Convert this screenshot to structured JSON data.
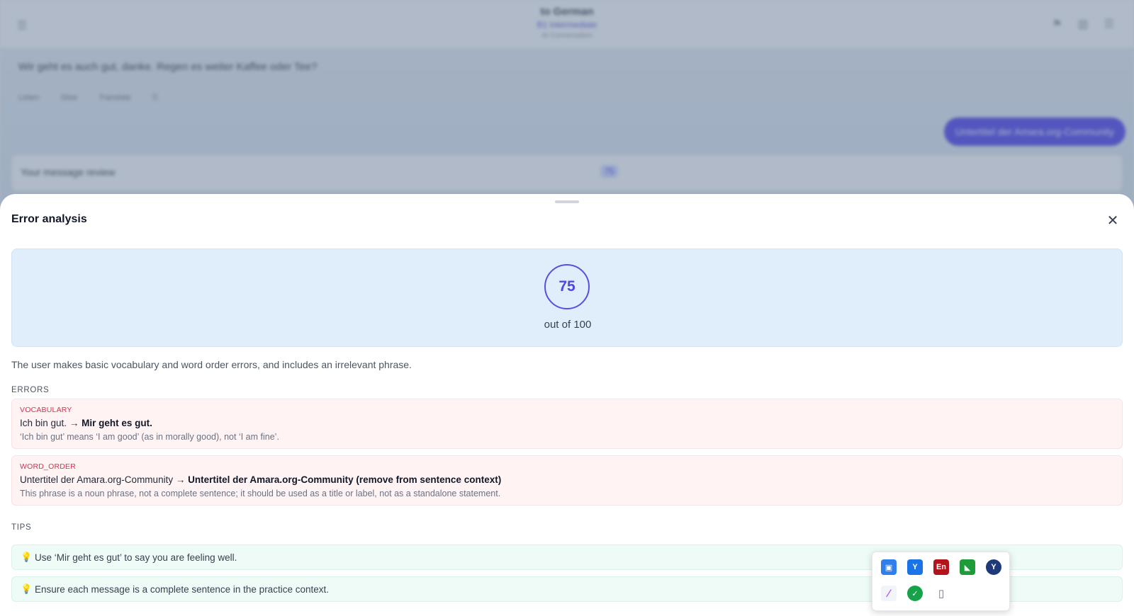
{
  "background": {
    "chat_title": "to German",
    "chat_subtitle": "B1 Intermediate",
    "chat_sub2": "AI Conversation",
    "message_text": "Wir geht es auch gut, danke. Regen es weiter Kaffee oder Tee?",
    "message_actions": [
      "Listen",
      "Slow",
      "Translate",
      "⎘"
    ],
    "user_bubble": "Untertitel der Amara.org-Community",
    "review_label": "Your message review",
    "review_badge": "75"
  },
  "sheet": {
    "title": "Error analysis",
    "close_icon": "✕",
    "score": "75",
    "score_out_of": "out of 100",
    "summary": "The user makes basic vocabulary and word order errors, and includes an irrelevant phrase.",
    "errors_label": "ERRORS",
    "errors": [
      {
        "type": "VOCABULARY",
        "original": "Ich bin gut.",
        "arrow": "→",
        "correction": "Mir geht es gut.",
        "explanation": "‘Ich bin gut’ means ‘I am good’ (as in morally good), not ‘I am fine’."
      },
      {
        "type": "WORD_ORDER",
        "original": "Untertitel der Amara.org-Community",
        "arrow": "→",
        "correction": "Untertitel der Amara.org-Community (remove from sentence context)",
        "explanation": "This phrase is a noun phrase, not a complete sentence; it should be used as a title or label, not as a standalone statement."
      }
    ],
    "tips_label": "TIPS",
    "tip_icon": "💡",
    "tips": [
      "Use ‘Mir geht es gut’ to say you are feeling well.",
      "Ensure each message is a complete sentence in the practice context."
    ]
  },
  "tray": {
    "icons": [
      {
        "name": "display-settings-icon",
        "glyph": "▣",
        "color": "#2f80ed"
      },
      {
        "name": "yandex-browser-icon",
        "glyph": "Y",
        "color": "#1a73e8"
      },
      {
        "name": "dictionary-en-icon",
        "glyph": "En",
        "color": "#b3141c"
      },
      {
        "name": "nvidia-icon",
        "glyph": "◣",
        "color": "#1f9c3a"
      },
      {
        "name": "yandex-icon",
        "glyph": "Y",
        "color": "#1e3a78"
      },
      {
        "name": "pen-icon",
        "glyph": "∕",
        "color": "#a855f7"
      },
      {
        "name": "security-shield-icon",
        "glyph": "✓",
        "color": "#16a34a"
      },
      {
        "name": "usb-drive-icon",
        "glyph": "▯",
        "color": "#6b7280"
      }
    ]
  }
}
